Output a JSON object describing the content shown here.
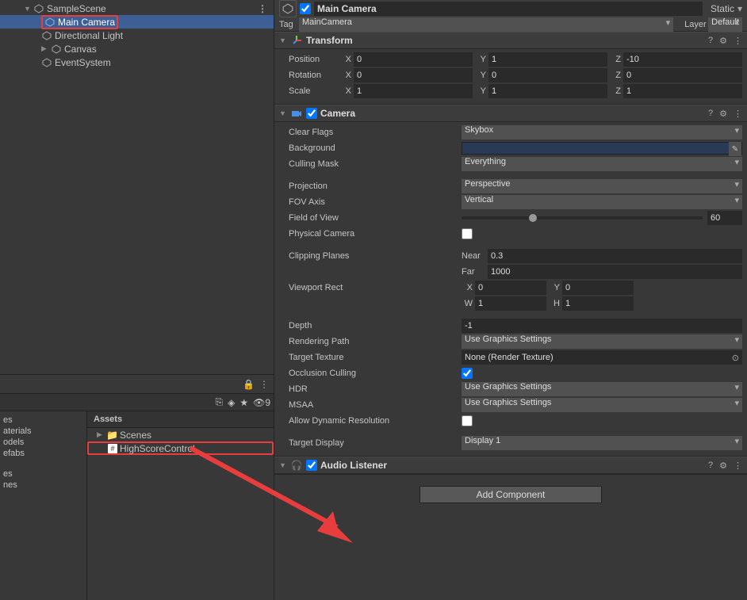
{
  "hierarchy": {
    "scene": "SampleScene",
    "items": [
      "Main Camera",
      "Directional Light",
      "Canvas",
      "EventSystem"
    ]
  },
  "project": {
    "assets_header": "Assets",
    "left_items": [
      "es",
      "aterials",
      "odels",
      "efabs",
      "",
      "es",
      "nes"
    ],
    "hidden_count": "9",
    "items": [
      "Scenes",
      "HighScoreControl"
    ]
  },
  "inspector": {
    "name": "Main Camera",
    "static_label": "Static",
    "tag_label": "Tag",
    "tag_value": "MainCamera",
    "layer_label": "Layer",
    "layer_value": "Default"
  },
  "transform": {
    "title": "Transform",
    "position": "Position",
    "pos": {
      "x": "0",
      "y": "1",
      "z": "-10"
    },
    "rotation": "Rotation",
    "rot": {
      "x": "0",
      "y": "0",
      "z": "0"
    },
    "scale": "Scale",
    "scl": {
      "x": "1",
      "y": "1",
      "z": "1"
    }
  },
  "camera": {
    "title": "Camera",
    "clear_flags": "Clear Flags",
    "clear_flags_v": "Skybox",
    "background": "Background",
    "culling_mask": "Culling Mask",
    "culling_mask_v": "Everything",
    "projection": "Projection",
    "projection_v": "Perspective",
    "fov_axis": "FOV Axis",
    "fov_axis_v": "Vertical",
    "fov": "Field of View",
    "fov_v": "60",
    "physical": "Physical Camera",
    "clipping": "Clipping Planes",
    "near": "Near",
    "near_v": "0.3",
    "far": "Far",
    "far_v": "1000",
    "viewport": "Viewport Rect",
    "vp": {
      "x": "0",
      "y": "0",
      "w": "1",
      "h": "1"
    },
    "depth": "Depth",
    "depth_v": "-1",
    "rendering": "Rendering Path",
    "rendering_v": "Use Graphics Settings",
    "target_tex": "Target Texture",
    "target_tex_v": "None (Render Texture)",
    "occlusion": "Occlusion Culling",
    "hdr": "HDR",
    "hdr_v": "Use Graphics Settings",
    "msaa": "MSAA",
    "msaa_v": "Use Graphics Settings",
    "allow_dynamic": "Allow Dynamic Resolution",
    "target_display": "Target Display",
    "target_display_v": "Display 1"
  },
  "audio_listener": {
    "title": "Audio Listener"
  },
  "add_component": "Add Component",
  "axis": {
    "x": "X",
    "y": "Y",
    "z": "Z",
    "w": "W",
    "h": "H"
  }
}
